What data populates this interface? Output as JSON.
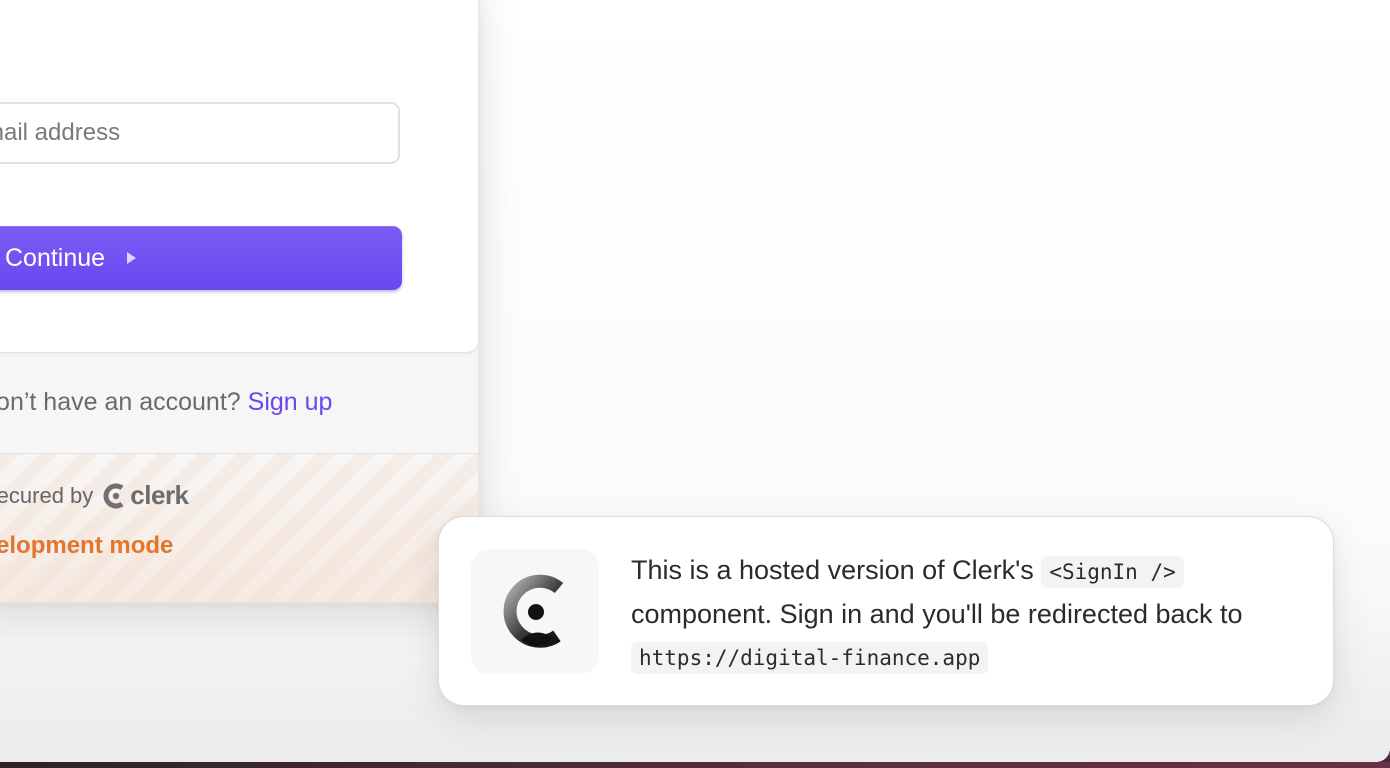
{
  "signin": {
    "email_placeholder": "Email address",
    "continue_label": "Continue",
    "no_account_text": "Don’t have an account?",
    "signup_label": "Sign up",
    "secured_by": "Secured by",
    "brand_name": "clerk",
    "dev_mode": "Development mode"
  },
  "toast": {
    "text_part1": "This is a hosted version of Clerk's",
    "code_component": "<SignIn />",
    "text_part2": "component. Sign in and you'll be redirected back to",
    "code_url": "https://digital-finance.app"
  },
  "colors": {
    "accent": "#6c47ff",
    "link": "#6a47ef",
    "dev_mode": "#e2762f"
  },
  "icons": {
    "arrow": "play-triangle-icon",
    "clerk_logo": "clerk-logo-icon"
  }
}
